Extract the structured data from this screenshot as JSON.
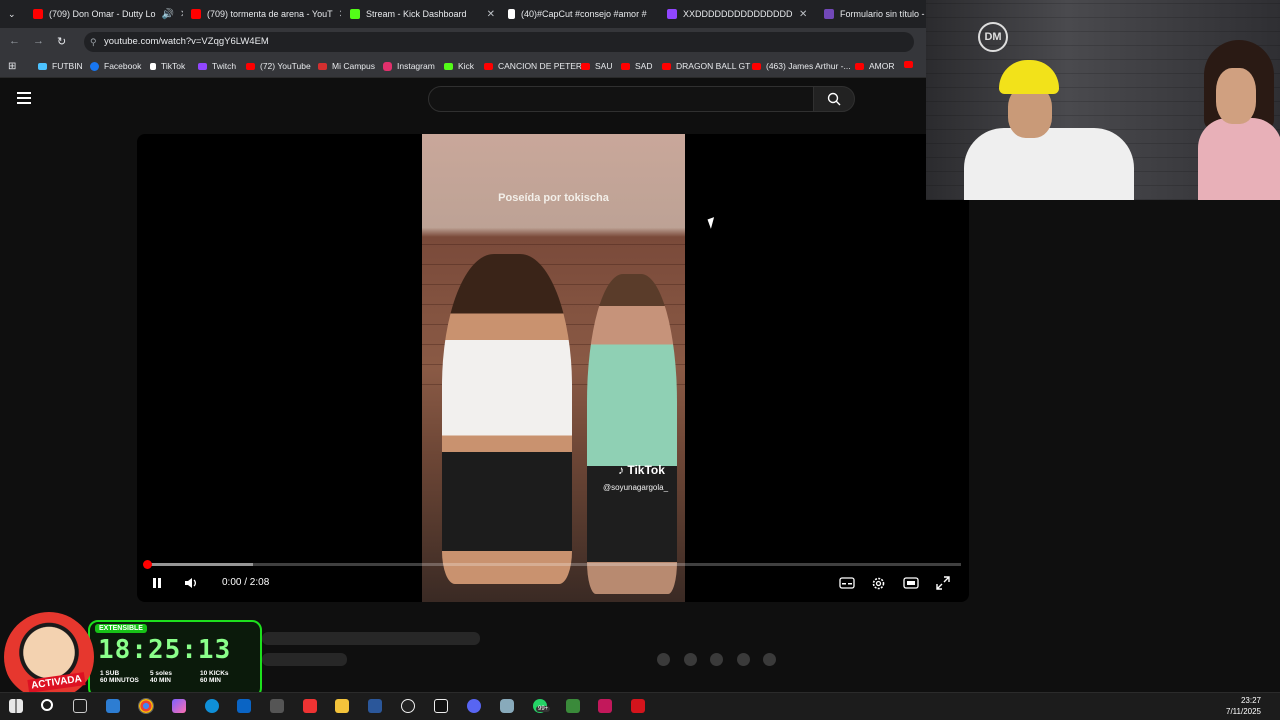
{
  "browser": {
    "tabs": [
      {
        "label": "(709) Don Omar - Dutty Lo",
        "color": "#ff0000"
      },
      {
        "label": "(709) tormenta de arena - YouT",
        "color": "#ff0000"
      },
      {
        "label": "Stream - Kick Dashboard",
        "color": "#53fc18"
      },
      {
        "label": "(40)#CapCut #consejo #amor #",
        "color": "#ffffff"
      },
      {
        "label": "XXDDDDDDDDDDDDDDDDDD",
        "color": "#9146ff"
      },
      {
        "label": "Formulario sin título - Fo",
        "color": "#7248b9"
      }
    ],
    "url": "youtube.com/watch?v=VZqgY6LW4EM",
    "bookmarks": [
      {
        "label": "FUTBIN",
        "color": "#4cc2ff"
      },
      {
        "label": "Facebook",
        "color": "#1877f2"
      },
      {
        "label": "TikTok",
        "color": "#ffffff"
      },
      {
        "label": "Twitch",
        "color": "#9146ff"
      },
      {
        "label": "(72) YouTube",
        "color": "#ff0000"
      },
      {
        "label": "Mi Campus",
        "color": "#d32f2f"
      },
      {
        "label": "Instagram",
        "color": "#e1306c"
      },
      {
        "label": "Kick",
        "color": "#53fc18"
      },
      {
        "label": "CANCION DE PETER",
        "color": "#ff0000"
      },
      {
        "label": "SAU",
        "color": "#ff0000"
      },
      {
        "label": "SAD",
        "color": "#ff0000"
      },
      {
        "label": "DRAGON BALL GT",
        "color": "#ff0000"
      },
      {
        "label": "(463) James Arthur -...",
        "color": "#ff0000"
      },
      {
        "label": "AMOR",
        "color": "#ff0000"
      }
    ]
  },
  "video": {
    "caption": "Poseída por tokischa",
    "watermark_brand": "TikTok",
    "watermark_handle": "@soyunagargola_",
    "time": "0:00 / 2:08",
    "progress_fraction": 0,
    "buffered_fraction": 0.13
  },
  "overlay": {
    "badge": "EXTENSIBLE",
    "timer": "18:25:13",
    "mascot_label": "ACTIVADA",
    "rules": [
      {
        "line1": "1 SUB",
        "line2": "60 MINUTOS"
      },
      {
        "line1": "5 soles",
        "line2": "40 MIN"
      },
      {
        "line1": "10 KICKs",
        "line2": "60 MIN"
      }
    ]
  },
  "webcam": {
    "logo": "DM"
  },
  "taskbar": {
    "time": "23:27",
    "date": "7/11/2025",
    "badge": "99+"
  }
}
